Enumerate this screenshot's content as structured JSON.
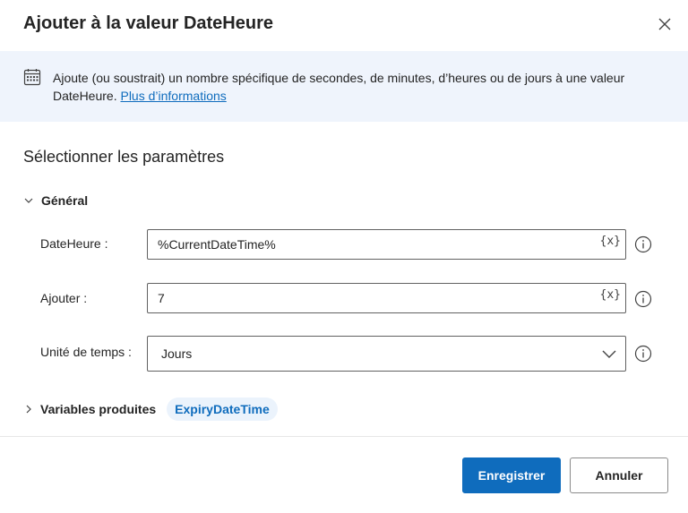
{
  "dialog": {
    "title": "Ajouter à la valeur DateHeure"
  },
  "info": {
    "text": "Ajoute (ou soustrait) un nombre spécifique de secondes, de minutes, d’heures ou de jours à une valeur DateHeure.",
    "link_label": "Plus d’informations",
    "icon": "calendar-icon"
  },
  "section": {
    "title": "Sélectionner les paramètres"
  },
  "general": {
    "label": "Général",
    "expanded": true
  },
  "fields": {
    "datetime": {
      "label": "DateHeure :",
      "value": "%CurrentDateTime%",
      "var_button": "{x}"
    },
    "add": {
      "label": "Ajouter :",
      "value": "7",
      "var_button": "{x}"
    },
    "unit": {
      "label": "Unité de temps :",
      "value": "Jours"
    }
  },
  "produced": {
    "label": "Variables produites",
    "variable": "ExpiryDateTime",
    "expanded": false
  },
  "buttons": {
    "save": "Enregistrer",
    "cancel": "Annuler"
  },
  "colors": {
    "accent": "#0f6cbd",
    "banner": "#eff4fc",
    "pill_bg": "#ebf3fc"
  }
}
